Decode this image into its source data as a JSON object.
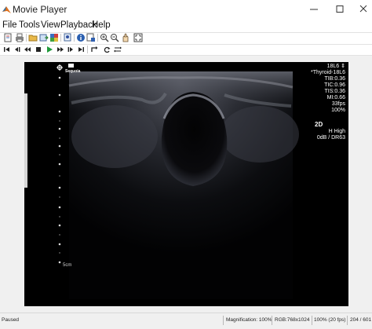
{
  "window": {
    "title": "Movie Player",
    "icon": "matlab-logo-icon"
  },
  "window_controls": [
    "minimize-icon",
    "maximize-icon",
    "close-icon"
  ],
  "menu": [
    "File",
    "Tools",
    "View",
    "Playback",
    "Help"
  ],
  "toolbar_icons": [
    "new-file-icon",
    "print-icon",
    "open-folder-icon",
    "export-icon",
    "colormap-icon",
    "pin-icon",
    "info-icon",
    "frame-rate-icon",
    "zoom-in-icon",
    "zoom-out-icon",
    "pan-icon",
    "fit-to-window-icon"
  ],
  "playback_icons": [
    "go-to-first-icon",
    "step-back-icon",
    "rewind-icon",
    "stop-icon",
    "play-icon",
    "fast-forward-icon",
    "step-forward-icon",
    "go-to-last-icon",
    "jump-to-icon",
    "loop-icon",
    "playback-direction-icon"
  ],
  "overlay": {
    "logo": "Sequoia",
    "lines": [
      "18L6 ⇕",
      "*Thyroid-18L6",
      "TIB:0.36",
      "TIC:0.96",
      "TIS:0.36",
      "MI:0.66",
      "33fps",
      "100%"
    ],
    "mode": "2D",
    "gain": [
      "H High",
      "0dB / DR63"
    ],
    "depth_label": "5cm"
  },
  "status": {
    "state": "Paused",
    "magnification": "Magnification: 100%",
    "color_info": "RGB:768x1024",
    "rate": "100% (20 fps)",
    "frame": "204 / 601"
  },
  "colors": {
    "background": "#f0f0f0",
    "image_bg": "#000000",
    "overlay_text": "#ffffff"
  }
}
